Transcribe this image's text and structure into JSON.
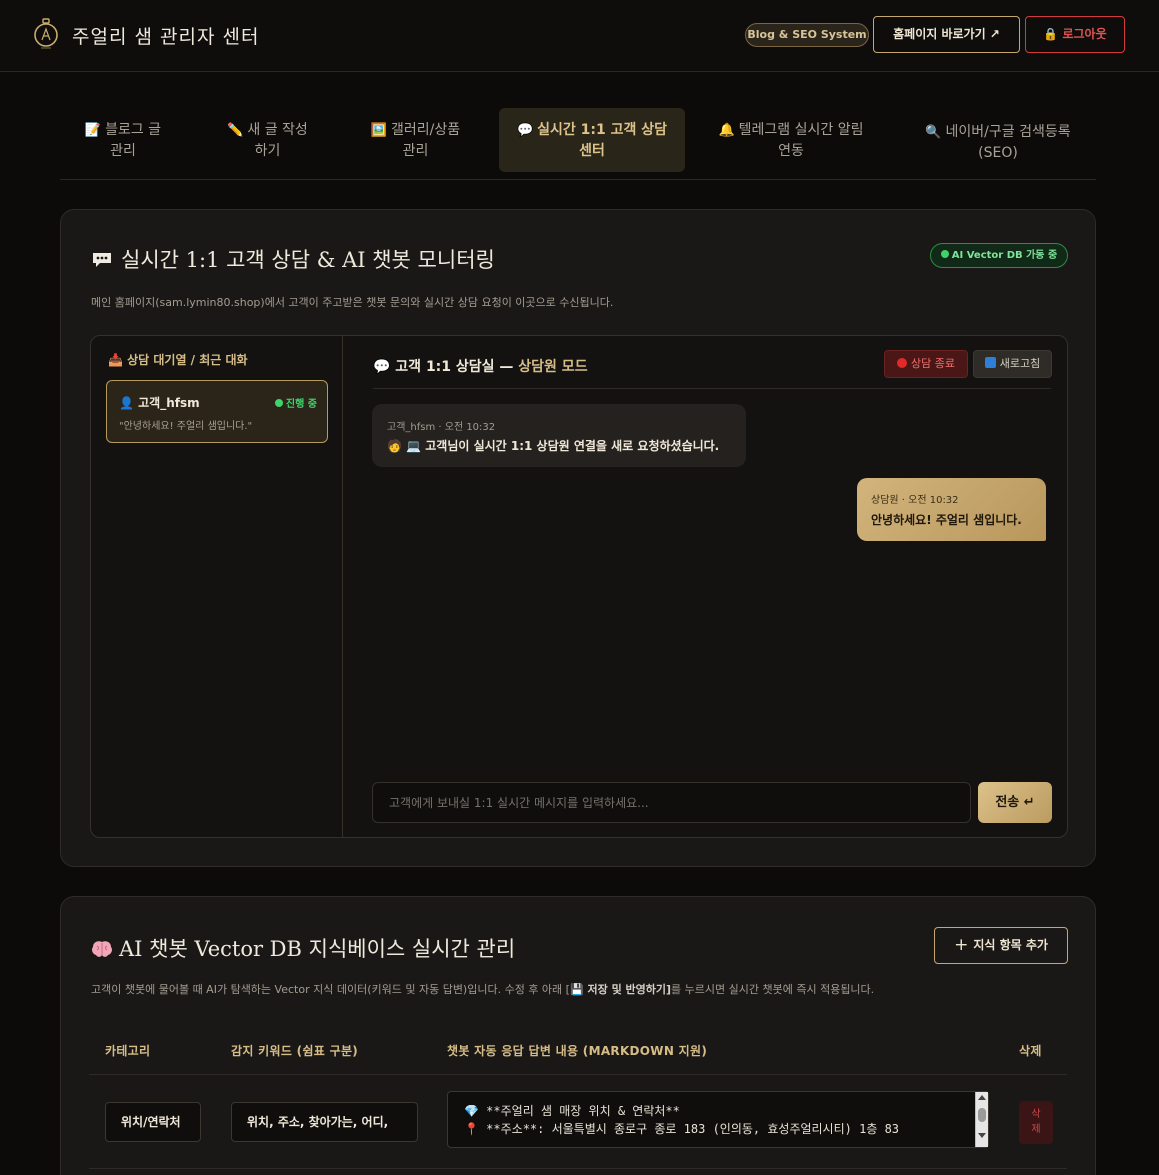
{
  "header": {
    "title": "주얼리 샘 관리자 센터",
    "blog_badge": "Blog & SEO System",
    "home_button": "홈페이지 바로가기 ↗",
    "logout_button": "🔒 로그아웃"
  },
  "tabs": [
    {
      "icon": "📝",
      "line1": "블로그 글",
      "line2": "관리"
    },
    {
      "icon": "✏️",
      "line1": "새 글 작성",
      "line2": "하기"
    },
    {
      "icon": "🖼️",
      "line1": "갤러리/상품",
      "line2": "관리"
    },
    {
      "icon": "💬",
      "line1": "실시간 1:1 고객 상담",
      "line2": "센터"
    },
    {
      "icon": "🔔",
      "line1": "텔레그램 실시간 알림",
      "line2": "연동"
    },
    {
      "icon": "🔍",
      "line1": "네이버/구글 검색등록",
      "line2": "(SEO)"
    }
  ],
  "consult": {
    "title": "실시간 1:1 고객 상담 & AI 챗봇 모니터링",
    "ai_badge": "AI Vector DB 가동 중",
    "description": "메인 홈페이지(sam.lymin80.shop)에서 고객이 주고받은 챗봇 문의와 실시간 상담 요청이 이곳으로 수신됩니다.",
    "queue_title": "📥 상담 대기열 / 최근 대화",
    "queue_item": {
      "name": "👤 고객_hfsm",
      "status": "진행 중",
      "preview": "\"안녕하세요! 주얼리 샘입니다.\""
    },
    "room_title": "💬 고객 1:1 상담실 — ",
    "room_mode": "상담원 모드",
    "end_button": "상담 종료",
    "refresh_button": "새로고침",
    "messages": [
      {
        "meta": "고객_hfsm · 오전 10:32",
        "text": "🧑 💻 고객님이 실시간 1:1 상담원 연결을 새로 요청하셨습니다."
      },
      {
        "meta": "상담원 · 오전 10:32",
        "text": "안녕하세요! 주얼리 샘입니다."
      }
    ],
    "input_placeholder": "고객에게 보내실 1:1 실시간 메시지를 입력하세요...",
    "send_button": "전송 ↵"
  },
  "kb": {
    "title": "AI 챗봇 Vector DB 지식베이스 실시간 관리",
    "add_button": "지식 항목 추가",
    "description_pre": "고객이 챗봇에 물어볼 때 AI가 탐색하는 Vector 지식 데이터(키워드 및 자동 답변)입니다. 수정 후 아래 [",
    "description_bold": "💾 저장 및 반영하기]",
    "description_post": "를 누르시면 실시간 챗봇에 즉시 적용됩니다.",
    "headers": {
      "category": "카테고리",
      "keywords": "감지 키워드 (쉼표 구분)",
      "answer": "챗봇 자동 응답 답변 내용 (MARKDOWN 지원)",
      "delete": "삭제"
    },
    "rows": [
      {
        "category": "위치/연락처",
        "keywords": "위치, 주소, 찾아가는, 어디,",
        "answer_line1": "💎 **주얼리 샘 매장 위치 & 연락처**",
        "answer_line2": "📍 **주소**: 서울특별시 종로구 종로 183 (인의동, 효성주얼리시티) 1층 83",
        "delete_label1": "삭",
        "delete_label2": "제"
      }
    ]
  },
  "colors": {
    "accent_gold": "#d6bd87",
    "status_green": "#3fd36a",
    "danger_red": "#e25252"
  }
}
